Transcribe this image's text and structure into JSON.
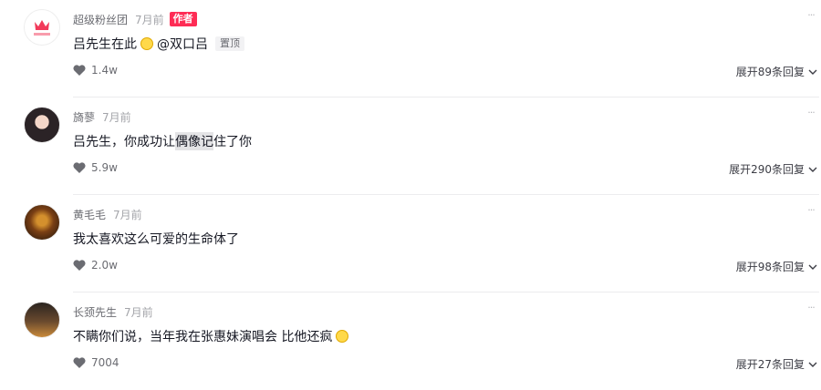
{
  "comments": [
    {
      "username": "超级粉丝团",
      "time": "7月前",
      "author_badge": "作者",
      "text_before": "吕先生在此",
      "text_after": "@双口吕",
      "pinned_badge": "置顶",
      "likes": "1.4w",
      "expand_label": "展开89条回复"
    },
    {
      "username": "旖蓼",
      "time": "7月前",
      "text_before": "吕先生，你成功让",
      "text_highlight": "偶像记",
      "text_after": "住了你",
      "likes": "5.9w",
      "expand_label": "展开290条回复"
    },
    {
      "username": "黄毛毛",
      "time": "7月前",
      "text": "我太喜欢这么可爱的生命体了",
      "likes": "2.0w",
      "expand_label": "展开98条回复"
    },
    {
      "username": "长颈先生",
      "time": "7月前",
      "text": "不瞒你们说，当年我在张惠妹演唱会 比他还疯",
      "likes": "7004",
      "expand_label": "展开27条回复"
    }
  ],
  "icons": {
    "like": "heart-icon",
    "more": "more-dots-icon",
    "expand": "chevron-down-icon",
    "emoji": "emoji-icon"
  },
  "colors": {
    "author_badge": "#fe2c55",
    "name": "#6b6c72",
    "time": "#a3a4a9"
  }
}
